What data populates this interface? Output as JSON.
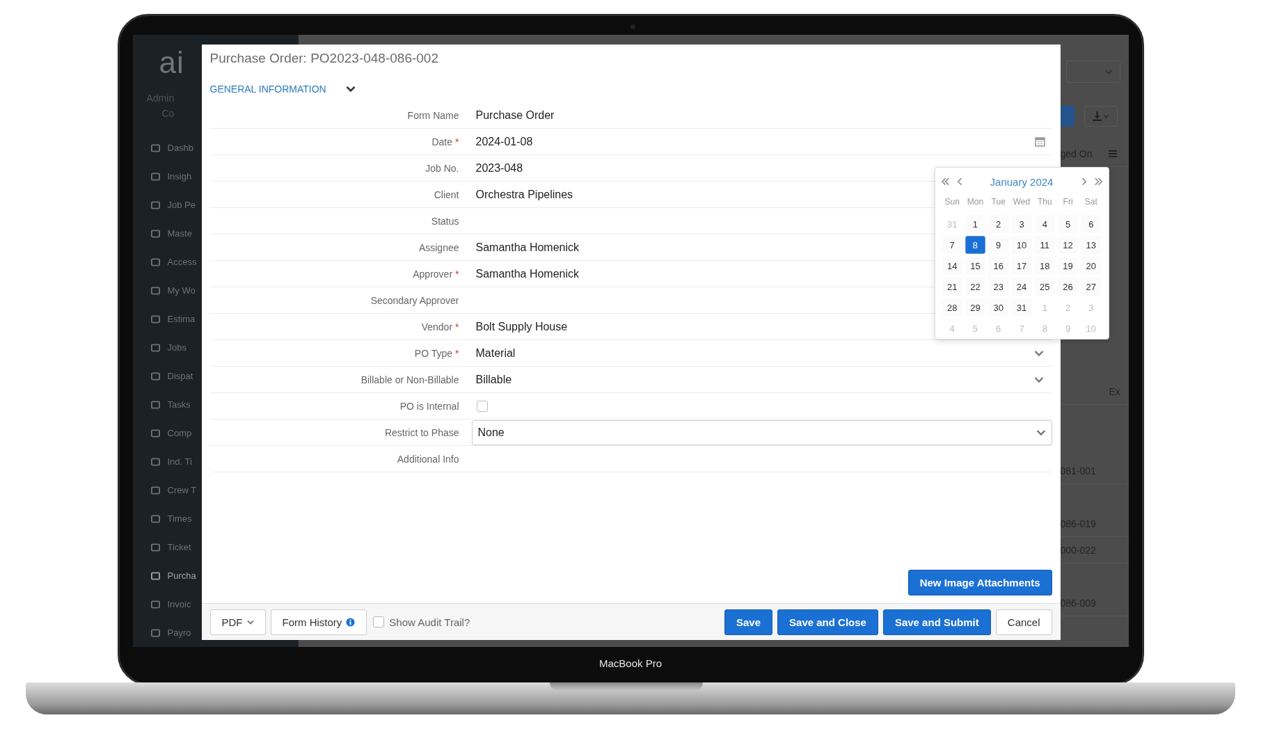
{
  "device": {
    "label": "MacBook Pro"
  },
  "sidebar": {
    "logo": "ai",
    "user_lines": [
      "Admin",
      "Co"
    ],
    "items": [
      {
        "label": "Dashb",
        "selected": false
      },
      {
        "label": "Insigh",
        "selected": false
      },
      {
        "label": "Job Pe",
        "selected": false
      },
      {
        "label": "Maste",
        "selected": false
      },
      {
        "label": "Access",
        "selected": false
      },
      {
        "label": "My Wo",
        "selected": false
      },
      {
        "label": "Estima",
        "selected": false
      },
      {
        "label": "Jobs",
        "selected": false
      },
      {
        "label": "Dispat",
        "selected": false
      },
      {
        "label": "Tasks",
        "selected": false
      },
      {
        "label": "Comp",
        "selected": false
      },
      {
        "label": "Ind. Ti",
        "selected": false
      },
      {
        "label": "Crew T",
        "selected": false
      },
      {
        "label": "Times",
        "selected": false
      },
      {
        "label": "Ticket",
        "selected": false
      },
      {
        "label": "Purcha",
        "selected": true
      },
      {
        "label": "Invoic",
        "selected": false
      },
      {
        "label": "Payro",
        "selected": false
      }
    ]
  },
  "background_table": {
    "cells": [
      {
        "text": "ged On"
      },
      {
        "text": "Ex"
      },
      {
        "text": "081-001"
      },
      {
        "text": "086-019"
      },
      {
        "text": "000-022"
      },
      {
        "text": "086-009"
      }
    ]
  },
  "dialog": {
    "title": "Purchase Order: PO2023-048-086-002",
    "section": {
      "label": "GENERAL INFORMATION",
      "expanded": true
    },
    "rows": [
      {
        "label": "Form Name",
        "kind": "text",
        "value": "Purchase Order"
      },
      {
        "label": "Date",
        "mark": "*",
        "kind": "date",
        "value": "2024-01-08"
      },
      {
        "label": "Job No.",
        "kind": "text",
        "value": "2023-048"
      },
      {
        "label": "Client",
        "kind": "text",
        "value": "Orchestra Pipelines"
      },
      {
        "label": "Status",
        "kind": "text"
      },
      {
        "label": "Assignee",
        "kind": "text",
        "value": "Samantha Homenick"
      },
      {
        "label": "Approver",
        "mark": "*",
        "kind": "text",
        "value": "Samantha Homenick"
      },
      {
        "label": "Secondary Approver",
        "kind": "text"
      },
      {
        "label": "Vendor",
        "mark": "*",
        "kind": "text",
        "value": "Bolt Supply House"
      },
      {
        "label": "PO Type",
        "mark": "*",
        "kind": "select",
        "value": "Material"
      },
      {
        "label": "Billable or Non-Billable",
        "kind": "select",
        "value": "Billable"
      },
      {
        "label": "PO is Internal",
        "kind": "checkbox",
        "checked": false
      },
      {
        "label": "Restrict to Phase",
        "kind": "select_box",
        "value": "None"
      },
      {
        "label": "Additional Info",
        "kind": "text"
      }
    ],
    "calendar": {
      "title": "January 2024",
      "weekdays": [
        "Sun",
        "Mon",
        "Tue",
        "Wed",
        "Thu",
        "Fri",
        "Sat"
      ],
      "days": [
        {
          "label": "31",
          "muted": true,
          "selected": false
        },
        {
          "label": "1",
          "muted": false,
          "selected": false
        },
        {
          "label": "2",
          "muted": false,
          "selected": false
        },
        {
          "label": "3",
          "muted": false,
          "selected": false
        },
        {
          "label": "4",
          "muted": false,
          "selected": false
        },
        {
          "label": "5",
          "muted": false,
          "selected": false
        },
        {
          "label": "6",
          "muted": false,
          "selected": false
        },
        {
          "label": "7",
          "muted": false,
          "selected": false
        },
        {
          "label": "8",
          "muted": false,
          "selected": true
        },
        {
          "label": "9",
          "muted": false,
          "selected": false
        },
        {
          "label": "10",
          "muted": false,
          "selected": false
        },
        {
          "label": "11",
          "muted": false,
          "selected": false
        },
        {
          "label": "12",
          "muted": false,
          "selected": false
        },
        {
          "label": "13",
          "muted": false,
          "selected": false
        },
        {
          "label": "14",
          "muted": false,
          "selected": false
        },
        {
          "label": "15",
          "muted": false,
          "selected": false
        },
        {
          "label": "16",
          "muted": false,
          "selected": false
        },
        {
          "label": "17",
          "muted": false,
          "selected": false
        },
        {
          "label": "18",
          "muted": false,
          "selected": false
        },
        {
          "label": "19",
          "muted": false,
          "selected": false
        },
        {
          "label": "20",
          "muted": false,
          "selected": false
        },
        {
          "label": "21",
          "muted": false,
          "selected": false
        },
        {
          "label": "22",
          "muted": false,
          "selected": false
        },
        {
          "label": "23",
          "muted": false,
          "selected": false
        },
        {
          "label": "24",
          "muted": false,
          "selected": false
        },
        {
          "label": "25",
          "muted": false,
          "selected": false
        },
        {
          "label": "26",
          "muted": false,
          "selected": false
        },
        {
          "label": "27",
          "muted": false,
          "selected": false
        },
        {
          "label": "28",
          "muted": false,
          "selected": false
        },
        {
          "label": "29",
          "muted": false,
          "selected": false
        },
        {
          "label": "30",
          "muted": false,
          "selected": false
        },
        {
          "label": "31",
          "muted": false,
          "selected": false
        },
        {
          "label": "1",
          "muted": true,
          "selected": false
        },
        {
          "label": "2",
          "muted": true,
          "selected": false
        },
        {
          "label": "3",
          "muted": true,
          "selected": false
        },
        {
          "label": "4",
          "muted": true,
          "selected": false
        },
        {
          "label": "5",
          "muted": true,
          "selected": false
        },
        {
          "label": "6",
          "muted": true,
          "selected": false
        },
        {
          "label": "7",
          "muted": true,
          "selected": false
        },
        {
          "label": "8",
          "muted": true,
          "selected": false
        },
        {
          "label": "9",
          "muted": true,
          "selected": false
        },
        {
          "label": "10",
          "muted": true,
          "selected": false
        }
      ]
    },
    "attach_button": "New Image Attachments",
    "footer": {
      "pdf": "PDF",
      "history": "Form History",
      "audit": {
        "label": "Show Audit Trail?",
        "checked": false
      },
      "buttons": [
        {
          "label": "Save",
          "kind": "primary"
        },
        {
          "label": "Save and Close",
          "kind": "primary"
        },
        {
          "label": "Save and Submit",
          "kind": "primary"
        },
        {
          "label": "Cancel",
          "kind": "default"
        }
      ]
    }
  }
}
